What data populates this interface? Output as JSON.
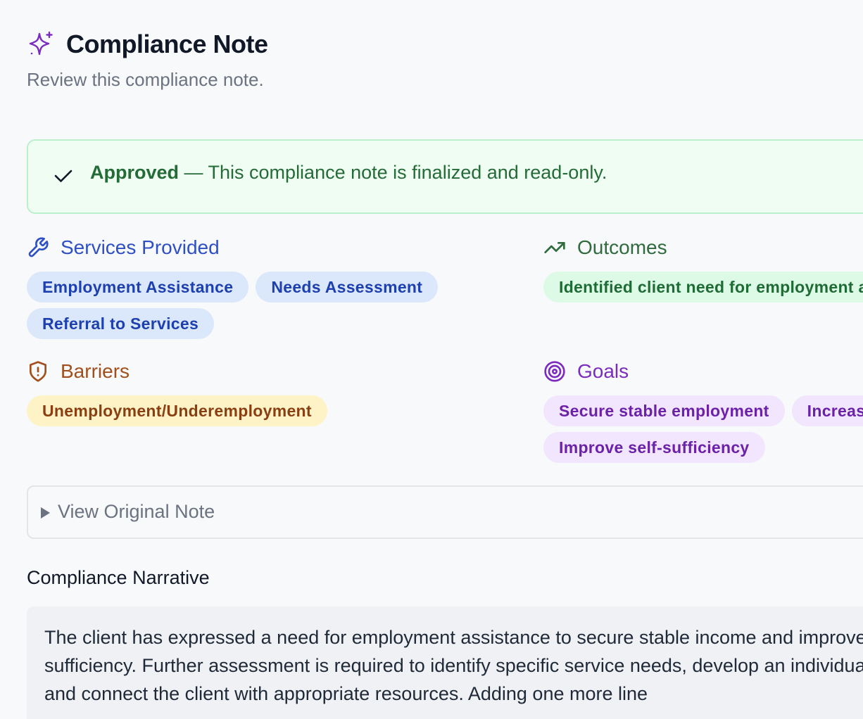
{
  "header": {
    "title": "Compliance Note",
    "subtitle": "Review this compliance note.",
    "icon": "sparkles-icon"
  },
  "banner": {
    "icon": "check-icon",
    "status": "Approved",
    "message": " — This compliance note is finalized and read-only."
  },
  "services": {
    "title": "Services Provided",
    "icon": "wrench-icon",
    "items": [
      "Employment Assistance",
      "Needs Assessment",
      "Referral to Services"
    ]
  },
  "outcomes": {
    "title": "Outcomes",
    "icon": "trending-up-icon",
    "items": [
      "Identified client need for employment assistance"
    ]
  },
  "barriers": {
    "title": "Barriers",
    "icon": "shield-alert-icon",
    "items": [
      "Unemployment/Underemployment"
    ]
  },
  "goals": {
    "title": "Goals",
    "icon": "target-icon",
    "items": [
      "Secure stable employment",
      "Increase household income",
      "Improve self-sufficiency"
    ]
  },
  "original_note": {
    "label": "View Original Note",
    "icon": "triangle-right-icon"
  },
  "narrative": {
    "title": "Compliance Narrative",
    "text": "The client has expressed a need for employment assistance to secure stable income and improve self-sufficiency. Further assessment is required to identify specific service needs, develop an individualized plan, and connect the client with appropriate resources. Adding one more line"
  },
  "colors": {
    "services": "#2f4fc4",
    "outcomes": "#2f6b3c",
    "barriers": "#a14f1c",
    "goals": "#7b2cbf",
    "approved": "#256b38"
  }
}
